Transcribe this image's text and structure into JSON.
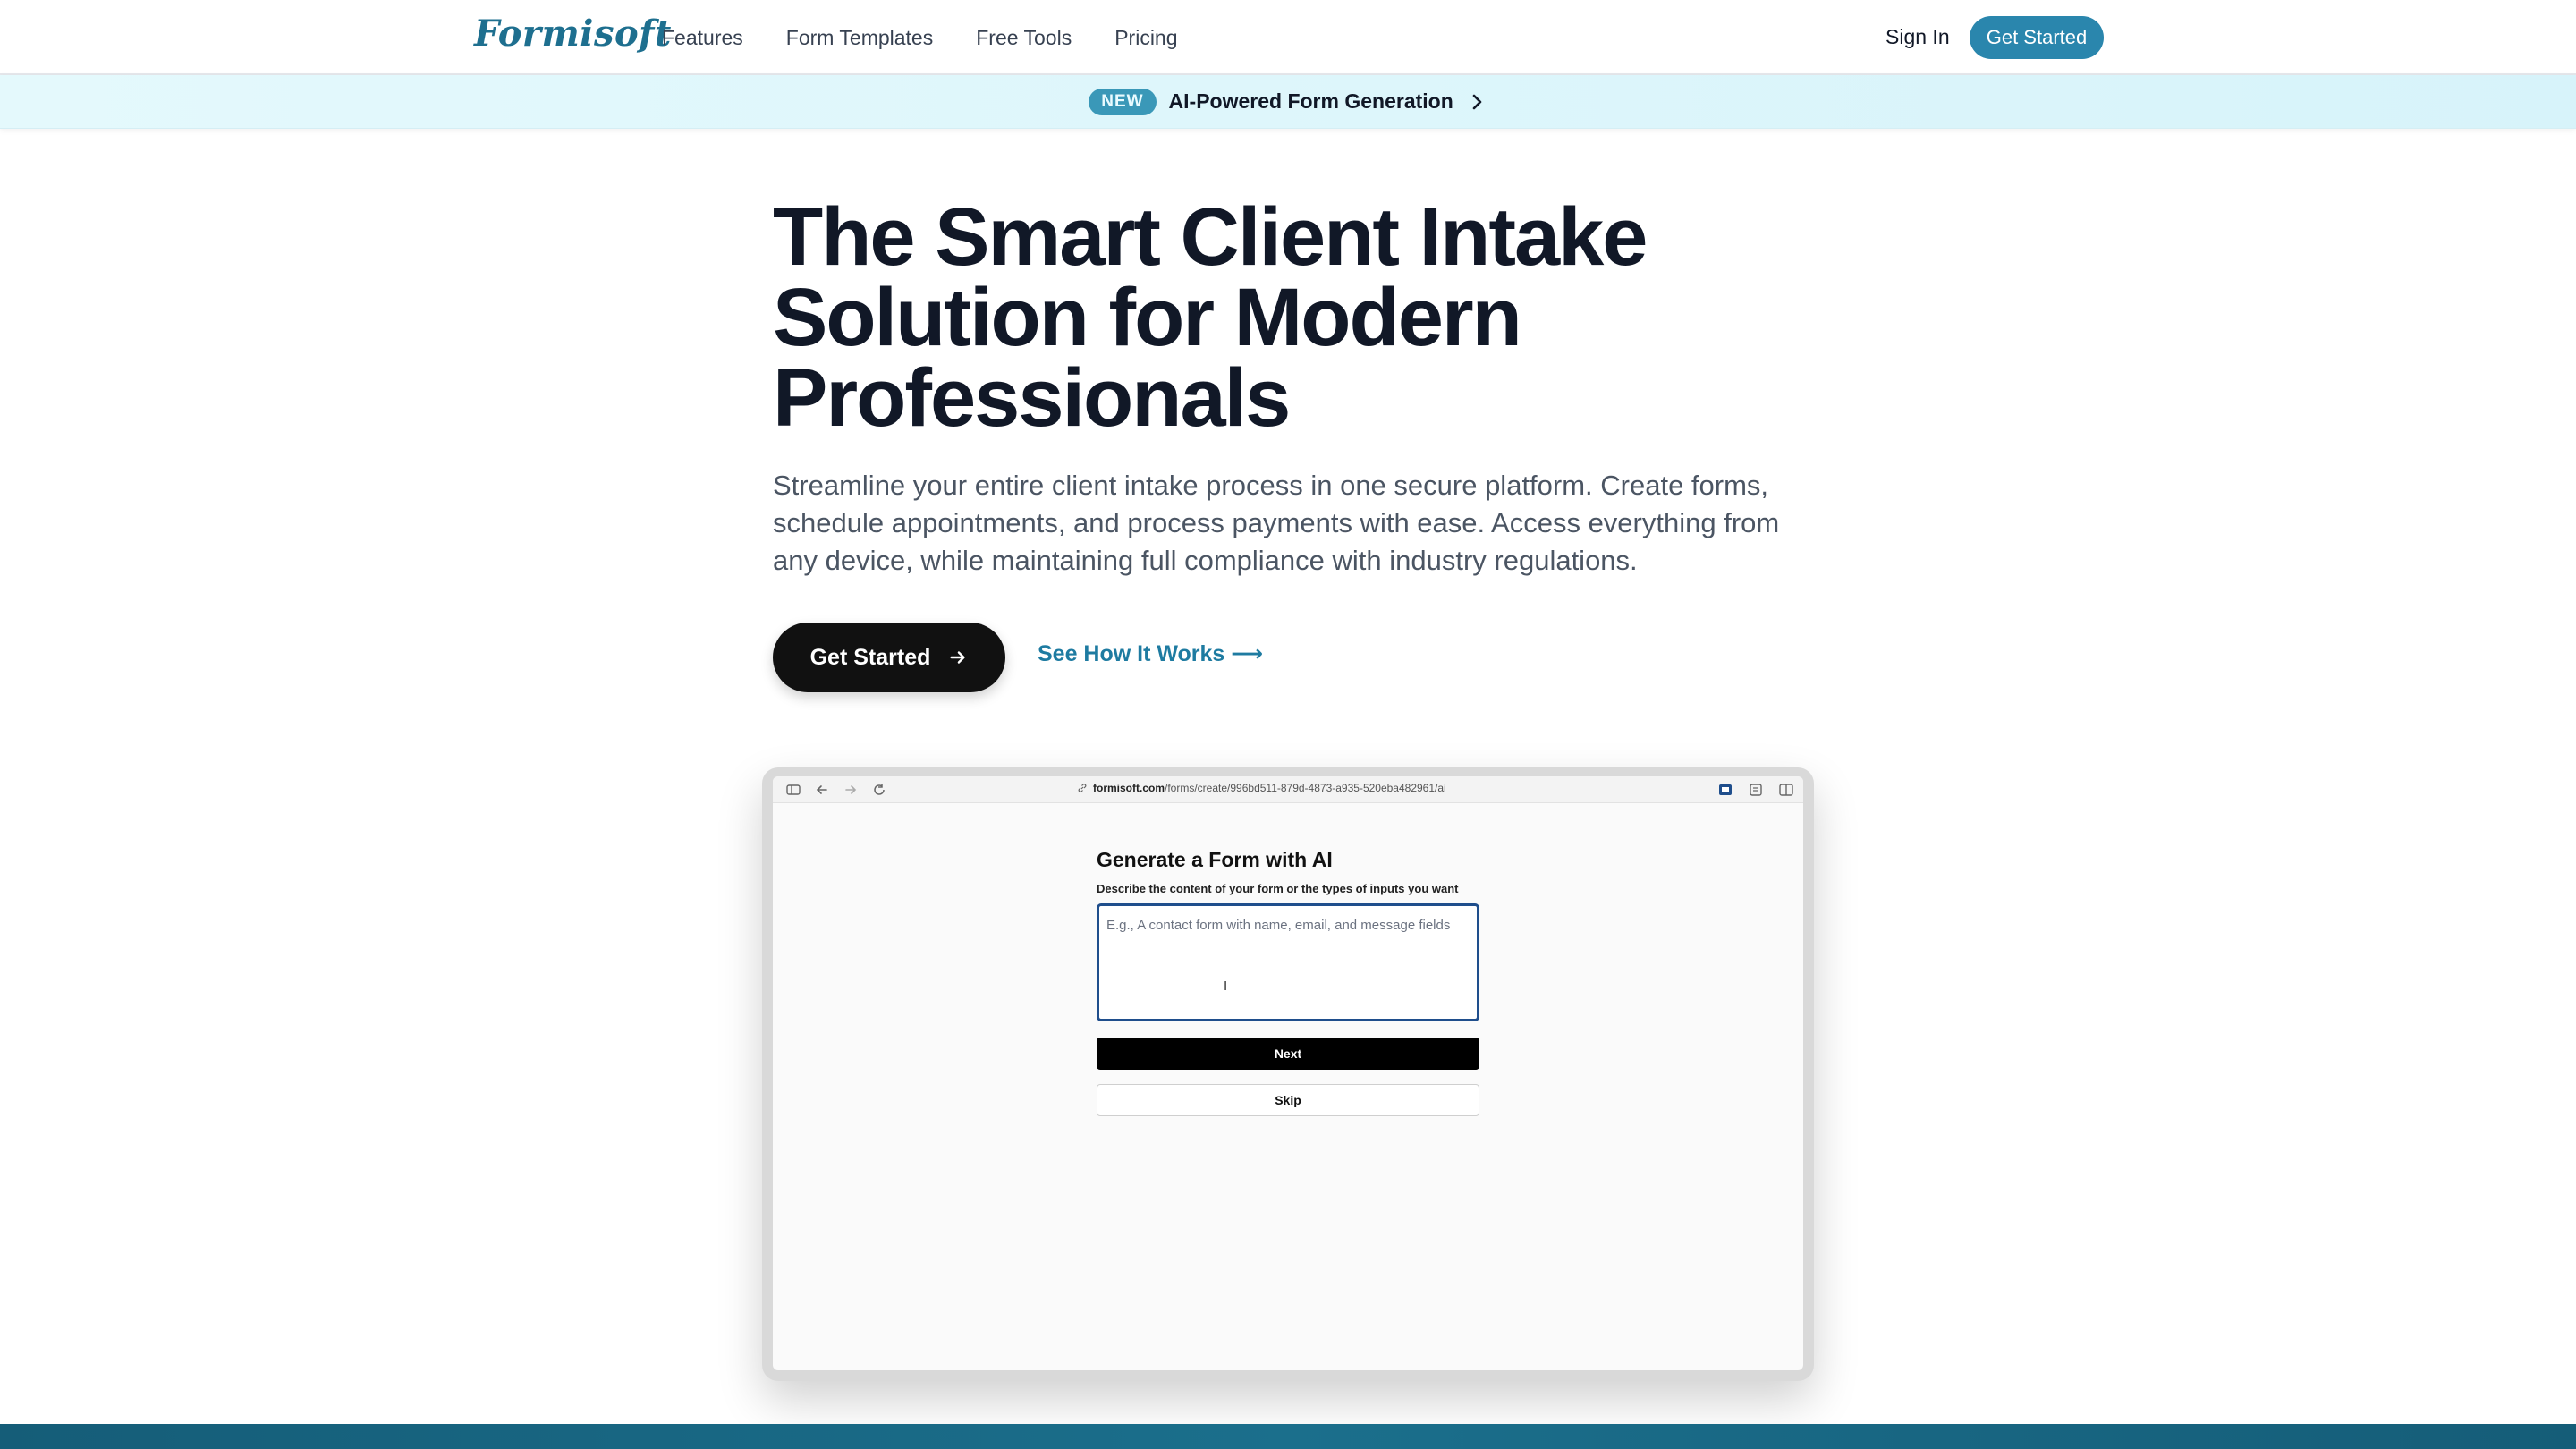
{
  "nav": {
    "logo": "Formisoft",
    "links": [
      "Features",
      "Form Templates",
      "Free Tools",
      "Pricing"
    ],
    "sign_in": "Sign In",
    "cta": "Get Started"
  },
  "banner": {
    "badge": "NEW",
    "text": "AI-Powered Form Generation",
    "icon": "chevron-right-icon"
  },
  "hero": {
    "title": "The Smart Client Intake Solution for Modern Professionals",
    "subtitle": "Streamline your entire client intake process in one secure platform. Create forms, schedule appointments, and process payments with ease. Access everything from any device, while maintaining full compliance with industry regulations.",
    "primary_button": "Get Started",
    "secondary_link": "See How It Works ⟶"
  },
  "mockup": {
    "url_domain": "formisoft.com",
    "url_path": "/forms/create/996bd511-879d-4873-a935-520eba482961/ai",
    "form_title": "Generate a Form with AI",
    "label": "Describe the content of your form or the types of inputs you want",
    "placeholder": "E.g., A contact form with name, email, and message fields",
    "next": "Next",
    "skip": "Skip"
  },
  "colors": {
    "brand": "#2a86ad",
    "logo": "#1e6f8f",
    "dark": "#111111"
  }
}
